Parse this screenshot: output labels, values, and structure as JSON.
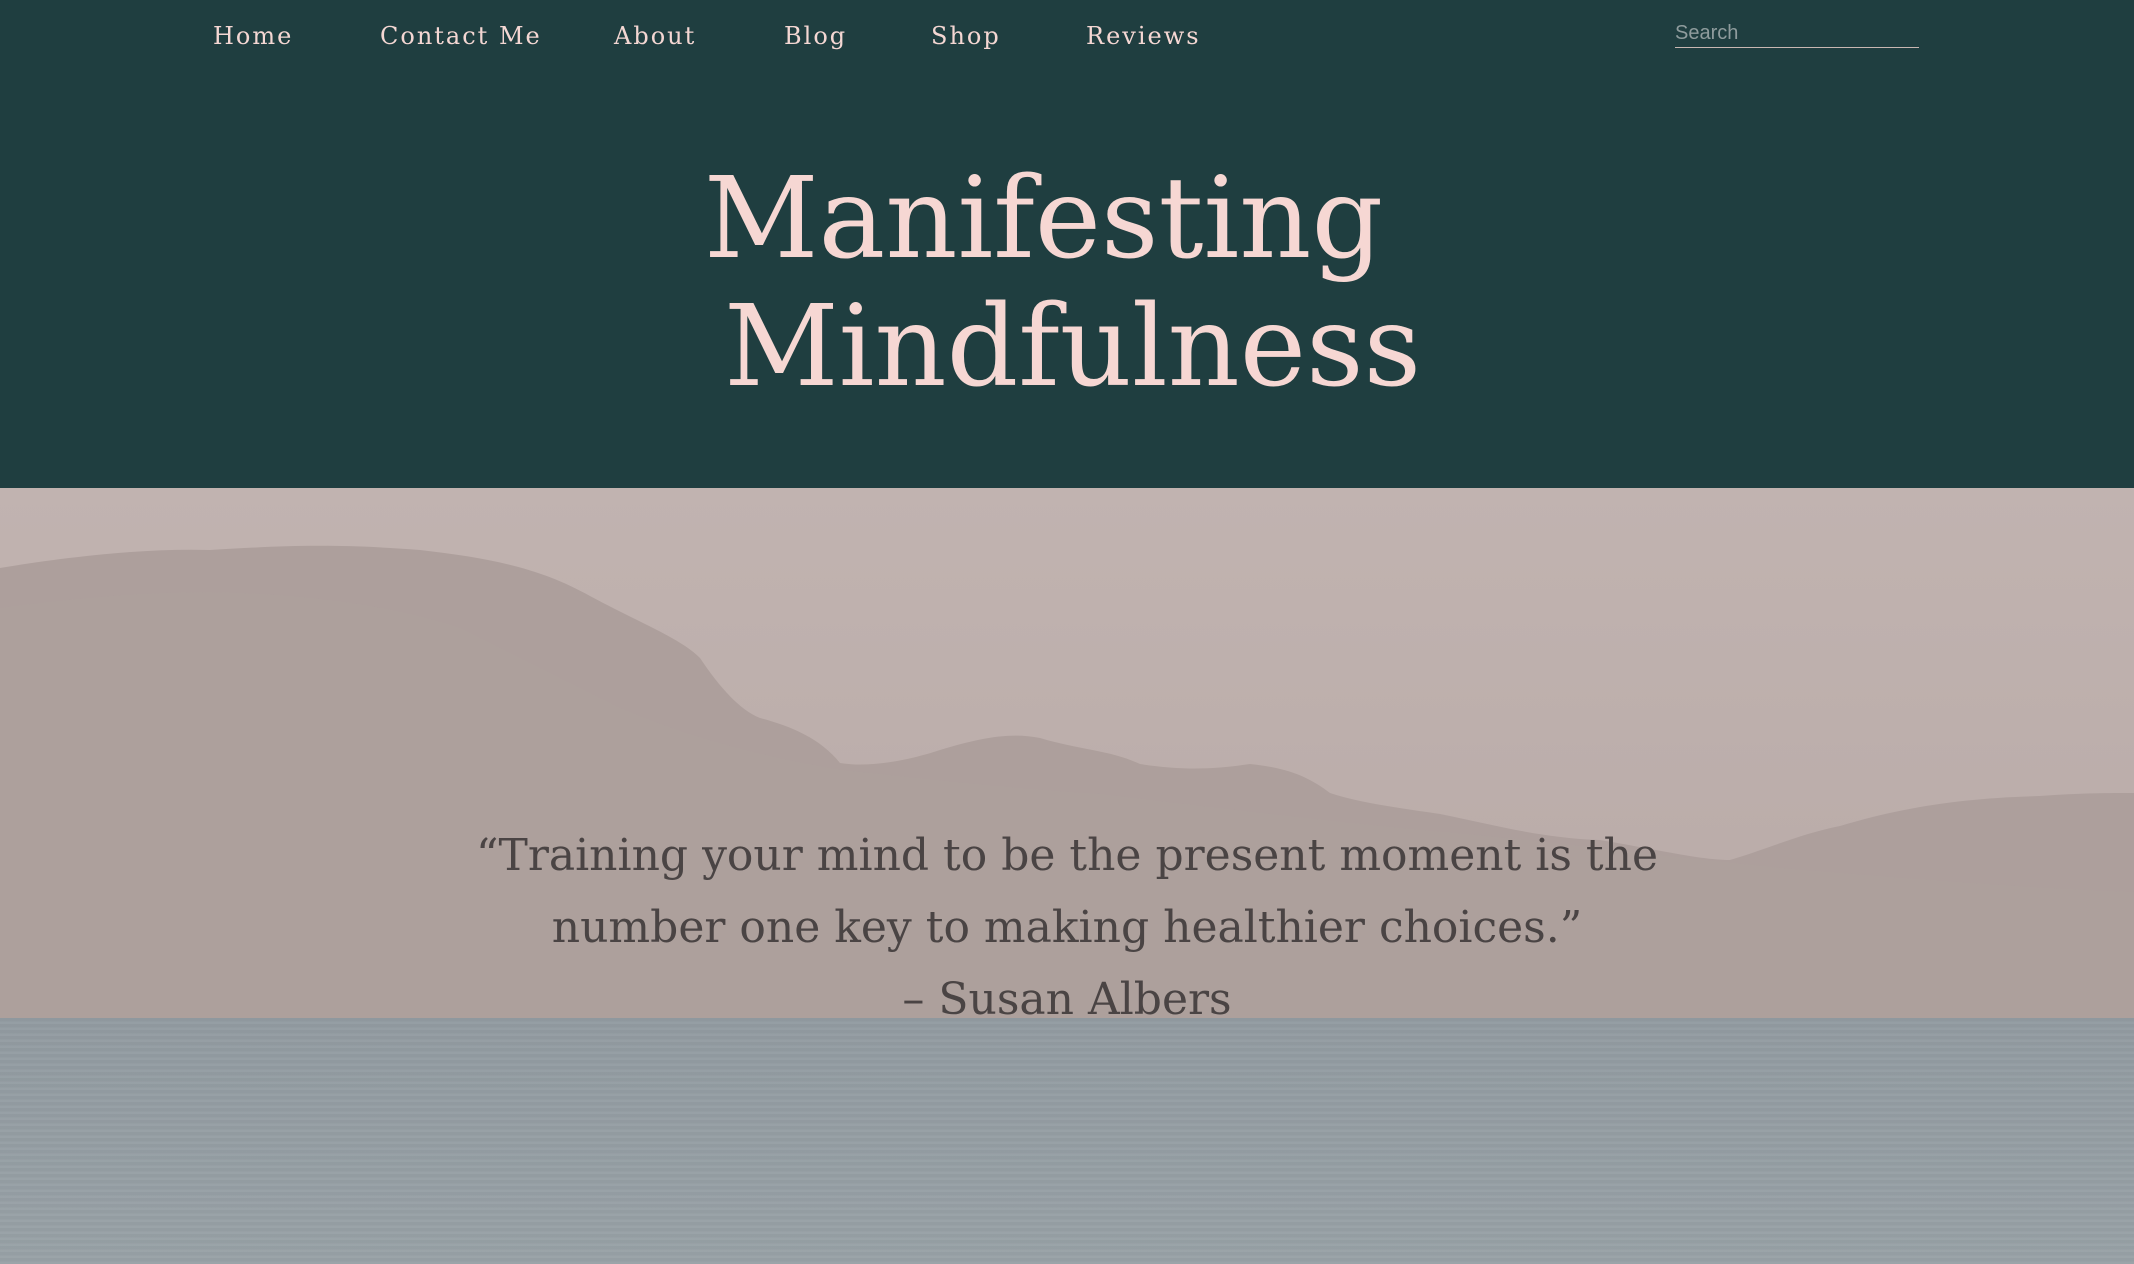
{
  "nav": {
    "items": [
      {
        "label": "Home"
      },
      {
        "label": "Contact Me"
      },
      {
        "label": "About"
      },
      {
        "label": "Blog"
      },
      {
        "label": "Shop"
      },
      {
        "label": "Reviews"
      }
    ]
  },
  "search": {
    "placeholder": "Search"
  },
  "hero_title": {
    "line1": "Manifesting",
    "line2": "Mindfulness"
  },
  "quote": {
    "line1": "“Training your mind to be the present moment is the",
    "line2": "number one key to making healthier choices.”",
    "attribution": "– Susan Albers"
  },
  "colors": {
    "header_bg": "#1f3e40",
    "title_pink": "#f6d7d3",
    "quote_text": "#4a4444",
    "sky": "#bfb1ad",
    "sea": "#959ea3"
  }
}
